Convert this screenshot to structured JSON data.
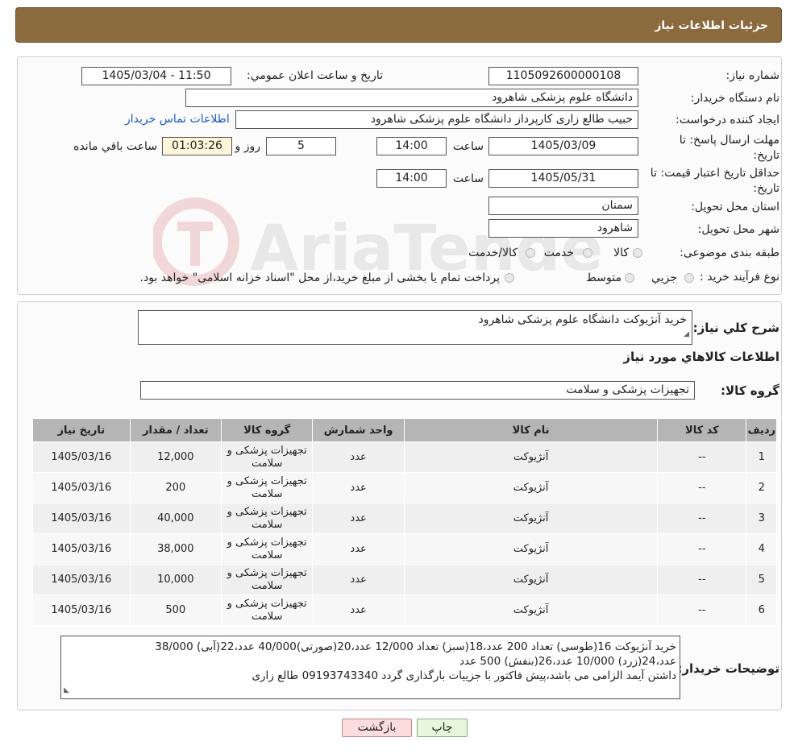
{
  "header": {
    "title": "جزئیات اطلاعات نیاز"
  },
  "form": {
    "need_number_label": "شماره نیاز:",
    "need_number": "1105092600000108",
    "announce_label": "تاریخ و ساعت اعلان عمومي:",
    "announce_value": "1405/03/04 - 11:50",
    "buyer_label": "نام دستگاه خريدار:",
    "buyer_value": "دانشگاه علوم پزشکی شاهرود",
    "creator_label": "ایجاد کننده درخواست:",
    "creator_value": "حبیب طالع زاری کارپرداز دانشگاه علوم پزشکی شاهرود",
    "contact_link": "اطلاعات تماس خریدار",
    "deadline_label": "مهلت ارسال پاسخ: تا تاریخ:",
    "deadline_date": "1405/03/09",
    "time_label": "ساعت",
    "deadline_time": "14:00",
    "days_value": "5",
    "days_label": "روز و",
    "remaining_time": "01:03:26",
    "remaining_label": "ساعت باقي مانده",
    "validity_label": "حداقل تاریخ اعتبار قیمت: تا تاریخ:",
    "validity_date": "1405/05/31",
    "validity_time": "14:00",
    "province_label": "استان محل تحویل:",
    "province_value": "سمنان",
    "city_label": "شهر محل تحویل:",
    "city_value": "شاهرود",
    "category_label": "طبقه بندی موضوعی:",
    "category_options": [
      "کالا",
      "خدمت",
      "کالا/خدمت"
    ],
    "process_label": "نوع فرآیند خرید :",
    "process_options": [
      "جزيي",
      "متوسط"
    ],
    "process_note": "پرداخت تمام یا بخشی از مبلغ خرید،از محل \"اسناد خزانه اسلامی\" خواهد بود."
  },
  "details": {
    "summary_label": "شرح کلي نياز:",
    "summary_value": "خرید آنژیوکت دانشگاه علوم پزشکی شاهرود",
    "goods_info_title": "اطلاعات کالاهاي مورد نياز",
    "group_label": "گروه کالا:",
    "group_value": "تجهیزات پزشکی و سلامت",
    "table": {
      "columns": [
        "رديف",
        "کد کالا",
        "نام کالا",
        "واحد شمارش",
        "گروه کالا",
        "تعداد / مقدار",
        "تاریخ نیاز"
      ],
      "rows": [
        {
          "row": "1",
          "code": "--",
          "name": "آنژیوکت",
          "unit": "عدد",
          "group": "تجهیزات پزشکی و سلامت",
          "qty": "12,000",
          "date": "1405/03/16"
        },
        {
          "row": "2",
          "code": "--",
          "name": "آنژیوکت",
          "unit": "عدد",
          "group": "تجهیزات پزشکی و سلامت",
          "qty": "200",
          "date": "1405/03/16"
        },
        {
          "row": "3",
          "code": "--",
          "name": "آنژیوکت",
          "unit": "عدد",
          "group": "تجهیزات پزشکی و سلامت",
          "qty": "40,000",
          "date": "1405/03/16"
        },
        {
          "row": "4",
          "code": "--",
          "name": "آنژیوکت",
          "unit": "عدد",
          "group": "تجهیزات پزشکی و سلامت",
          "qty": "38,000",
          "date": "1405/03/16"
        },
        {
          "row": "5",
          "code": "--",
          "name": "آنژیوکت",
          "unit": "عدد",
          "group": "تجهیزات پزشکی و سلامت",
          "qty": "10,000",
          "date": "1405/03/16"
        },
        {
          "row": "6",
          "code": "--",
          "name": "آنژیوکت",
          "unit": "عدد",
          "group": "تجهیزات پزشکی و سلامت",
          "qty": "500",
          "date": "1405/03/16"
        }
      ]
    },
    "buyer_notes_label": "توضیحات خریدار:",
    "buyer_notes_lines": [
      "خرید آنژیوکت 16(طوسی) تعداد 200 عدد،18(سبز) تعداد 12/000 عدد،20(صورتی)40/000 عدد،22(آبی) 38/000",
      "عدد،24(زرد) 10/000 عدد،26(بنفش) 500 عدد",
      "داشتن آیمد الزامی می باشد،پیش فاکتور با جزییات بارگذاری گردد 09193743340 طالع زاری"
    ]
  },
  "buttons": {
    "back": "بازگشت",
    "print": "چاپ"
  },
  "colors": {
    "header_bg": "#8b6a3e",
    "back_btn_bg": "#fcdcdc",
    "print_btn_bg": "#e6f7dc"
  },
  "watermark_text": "AriaTender.neT"
}
